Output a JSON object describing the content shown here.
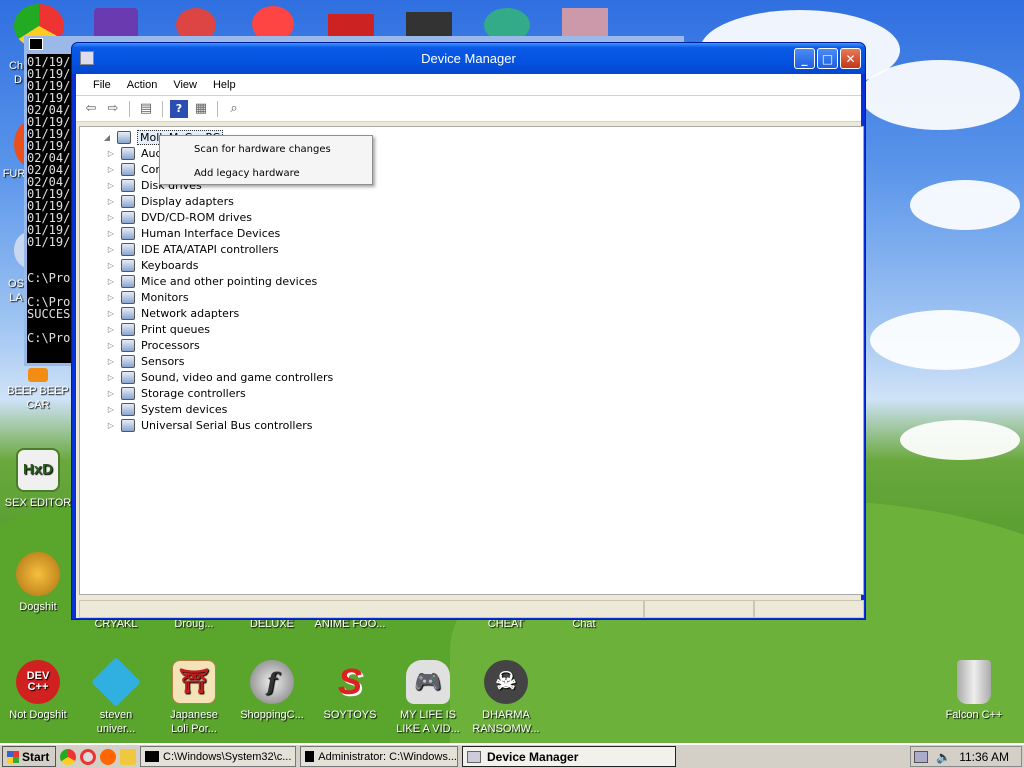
{
  "desktop": {
    "left_partial": [
      "Ch",
      "D",
      "FUR",
      "OS",
      "LA"
    ],
    "left_icons": [
      {
        "label_lines": [
          "BEEP BEEP",
          "CAR"
        ],
        "icon": "car-icon",
        "color": "#f28c12"
      },
      {
        "label_lines": [
          "SEX EDITOR"
        ],
        "icon": "hxd-icon",
        "color": "#4a7d2a",
        "badge": "HxD"
      },
      {
        "label_lines": [
          "Dogshit"
        ],
        "icon": "dev-cpp-icon",
        "color": "#c89020"
      }
    ],
    "middle_labels": [
      "CRYAKL",
      "Droug...",
      "DELUXE",
      "ANIME FOO...",
      "CHEAT",
      "Chat"
    ],
    "bottom_icons": [
      {
        "label_lines": [
          "Not Dogshit"
        ],
        "icon": "dev-cpp-icon",
        "color": "#d02020",
        "badge": "DEV C++"
      },
      {
        "label_lines": [
          "steven",
          "univer..."
        ],
        "icon": "diamond-icon",
        "color": "#30b0e0"
      },
      {
        "label_lines": [
          "Japanese",
          "Loli Por..."
        ],
        "icon": "torii-icon",
        "color": "#e8d6a0"
      },
      {
        "label_lines": [
          "ShoppingC..."
        ],
        "icon": "flash-icon",
        "color": "#8a8a8a",
        "badge": "f"
      },
      {
        "label_lines": [
          "SOYTOYS"
        ],
        "icon": "s-logo-icon",
        "color": "#e02020",
        "badge": "S"
      },
      {
        "label_lines": [
          "MY LIFE IS",
          "LIKE A VID..."
        ],
        "icon": "gamepad-icon",
        "color": "#d8d8d8"
      },
      {
        "label_lines": [
          "DHARMA",
          "RANSOMW..."
        ],
        "icon": "skull-icon",
        "color": "#404040"
      },
      {
        "label_lines": [
          "Falcon C++"
        ],
        "icon": "recycle-bin-icon",
        "color": "#c8c8c8"
      }
    ]
  },
  "console": {
    "lines": [
      "01/19/",
      "01/19/",
      "01/19/",
      "01/19/",
      "02/04/",
      "01/19/",
      "01/19/",
      "01/19/",
      "02/04/",
      "02/04/",
      "02/04/",
      "01/19/",
      "01/19/",
      "01/19/",
      "01/19/",
      "01/19/",
      "",
      "",
      "C:\\Pro",
      "",
      "C:\\Pro",
      "SUCCES",
      "",
      "C:\\Pro"
    ]
  },
  "device_manager": {
    "title": "Device Manager",
    "menu": [
      "File",
      "Action",
      "View",
      "Help"
    ],
    "root": "MollyMcCoePC",
    "categories": [
      {
        "label": "Aud",
        "icon": "speaker-icon"
      },
      {
        "label": "Com",
        "icon": "computer-icon"
      },
      {
        "label": "Disk drives",
        "icon": "disk-icon"
      },
      {
        "label": "Display adapters",
        "icon": "display-adapter-icon"
      },
      {
        "label": "DVD/CD-ROM drives",
        "icon": "dvd-icon"
      },
      {
        "label": "Human Interface Devices",
        "icon": "hid-icon"
      },
      {
        "label": "IDE ATA/ATAPI controllers",
        "icon": "ide-icon"
      },
      {
        "label": "Keyboards",
        "icon": "keyboard-icon"
      },
      {
        "label": "Mice and other pointing devices",
        "icon": "mouse-icon"
      },
      {
        "label": "Monitors",
        "icon": "monitor-icon"
      },
      {
        "label": "Network adapters",
        "icon": "network-icon"
      },
      {
        "label": "Print queues",
        "icon": "printer-icon"
      },
      {
        "label": "Processors",
        "icon": "processor-icon"
      },
      {
        "label": "Sensors",
        "icon": "sensor-icon"
      },
      {
        "label": "Sound, video and game controllers",
        "icon": "sound-icon"
      },
      {
        "label": "Storage controllers",
        "icon": "storage-icon"
      },
      {
        "label": "System devices",
        "icon": "system-icon"
      },
      {
        "label": "Universal Serial Bus controllers",
        "icon": "usb-icon"
      }
    ],
    "context_menu": [
      "Scan for hardware changes",
      "Add legacy hardware"
    ]
  },
  "taskbar": {
    "start": "Start",
    "tasks": [
      {
        "label": "C:\\Windows\\System32\\c...",
        "active": false
      },
      {
        "label": "Administrator: C:\\Windows...",
        "active": false
      },
      {
        "label": "Device Manager",
        "active": true
      }
    ],
    "clock": "11:36 AM"
  },
  "colors": {
    "xp_title_blue": "#0a5ae6",
    "close_red": "#c2361a",
    "taskbar_gray": "#d4d0c8"
  }
}
